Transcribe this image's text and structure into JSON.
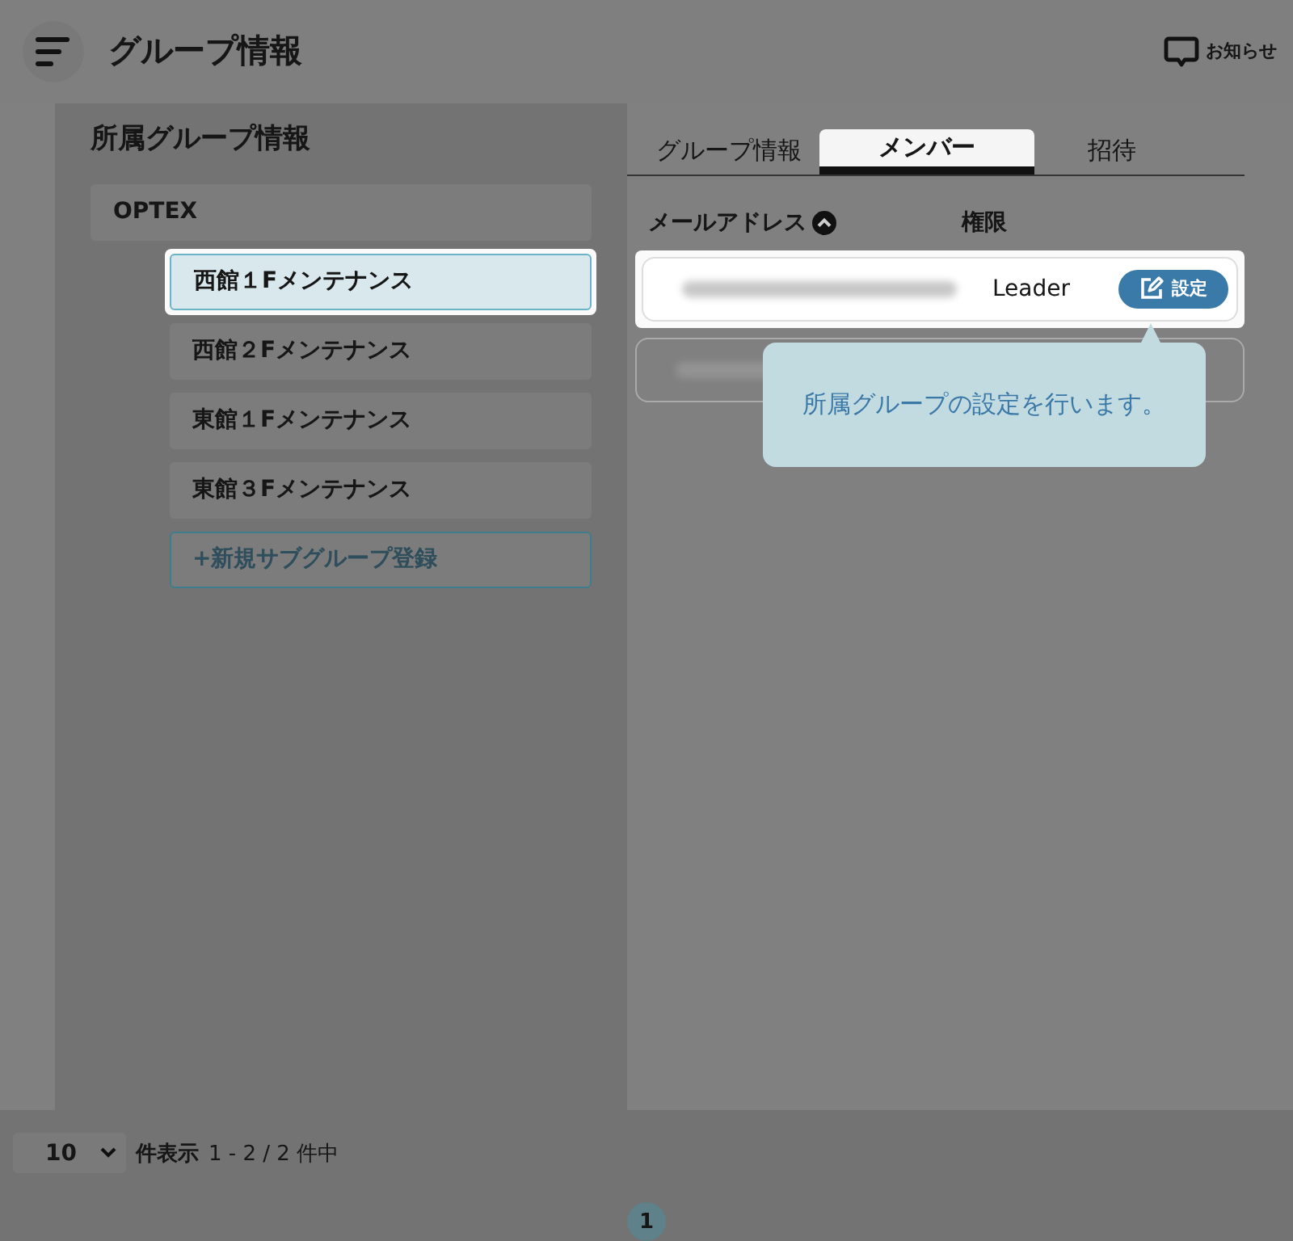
{
  "header": {
    "title": "グループ情報",
    "notice": "お知らせ"
  },
  "sidebar": {
    "heading": "所属グループ情報",
    "groups": [
      {
        "label": "OPTEX",
        "selected": false,
        "children": [
          {
            "label": "西館１Fメンテナンス",
            "selected": true
          },
          {
            "label": "西館２Fメンテナンス",
            "selected": false
          },
          {
            "label": "東館１Fメンテナンス",
            "selected": false
          },
          {
            "label": "東館３Fメンテナンス",
            "selected": false
          }
        ]
      }
    ],
    "add_button": "+新規サブグループ登録"
  },
  "tabs": [
    {
      "label": "グループ情報",
      "selected": false
    },
    {
      "label": "メンバー",
      "selected": true
    },
    {
      "label": "招待",
      "selected": false
    }
  ],
  "table": {
    "columns": [
      {
        "label": "メールアドレス",
        "sorted": true
      },
      {
        "label": "権限",
        "sorted": false
      }
    ],
    "rows": [
      {
        "highlighted": true,
        "role": "Leader",
        "action": "設定"
      },
      {
        "highlighted": false
      }
    ]
  },
  "tooltip": {
    "text": "所属グループの設定を行います。"
  },
  "pagination": {
    "page_size": "10",
    "size_label": "件表示",
    "range": "1 - 2 / 2 件中",
    "pages": [
      {
        "label": "1",
        "selected": true
      }
    ]
  }
}
